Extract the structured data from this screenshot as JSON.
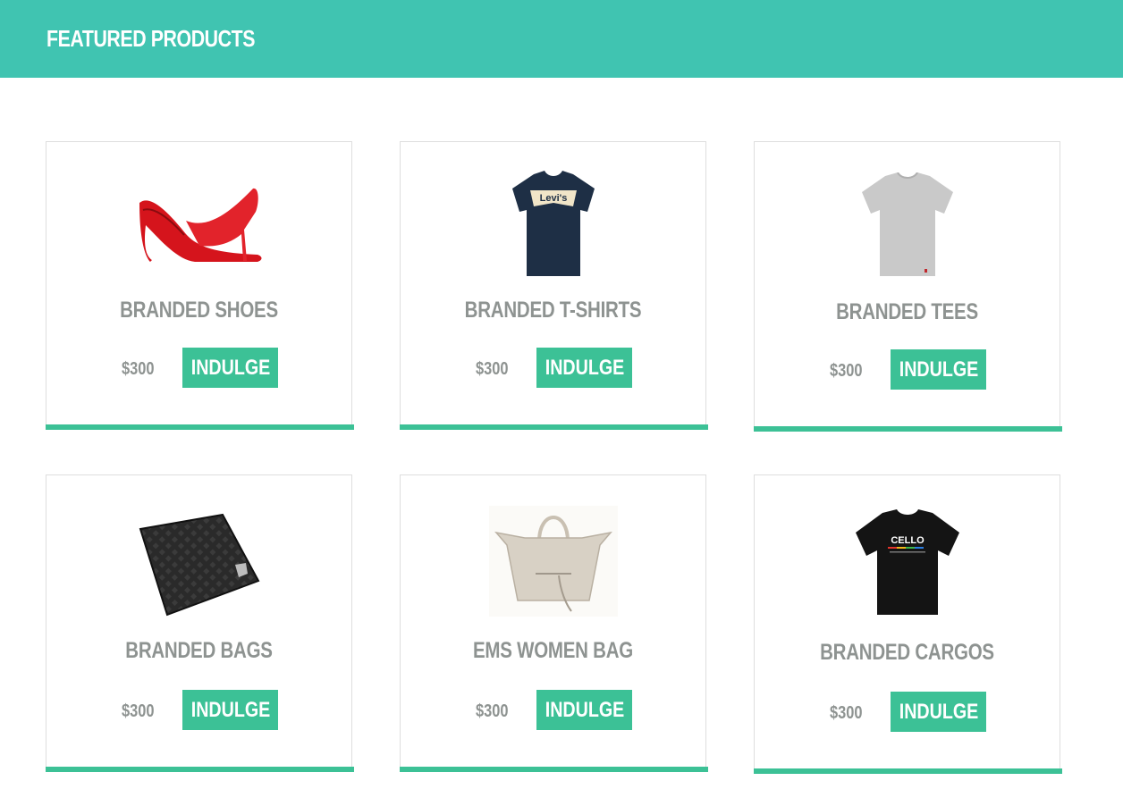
{
  "header": {
    "title": "FEATURED PRODUCTS"
  },
  "colors": {
    "header_bg": "#40c4b1",
    "accent": "#3cc196",
    "text_muted": "#8e9391"
  },
  "products": [
    {
      "name": "BRANDED SHOES",
      "price": "$300",
      "button": "INDULGE",
      "image_icon": "red-high-heels-image"
    },
    {
      "name": "BRANDED T-SHIRTS",
      "price": "$300",
      "button": "INDULGE",
      "image_icon": "levis-tshirt-image",
      "image_text": "Levi's"
    },
    {
      "name": "BRANDED TEES",
      "price": "$300",
      "button": "INDULGE",
      "image_icon": "grey-tee-image"
    },
    {
      "name": "BRANDED BAGS",
      "price": "$300",
      "button": "INDULGE",
      "image_icon": "black-wallet-image"
    },
    {
      "name": "EMS WOMEN BAG",
      "price": "$300",
      "button": "INDULGE",
      "image_icon": "beige-handbag-image"
    },
    {
      "name": "BRANDED CARGOS",
      "price": "$300",
      "button": "INDULGE",
      "image_icon": "black-cello-tshirt-image",
      "image_text": "CELLO"
    }
  ]
}
